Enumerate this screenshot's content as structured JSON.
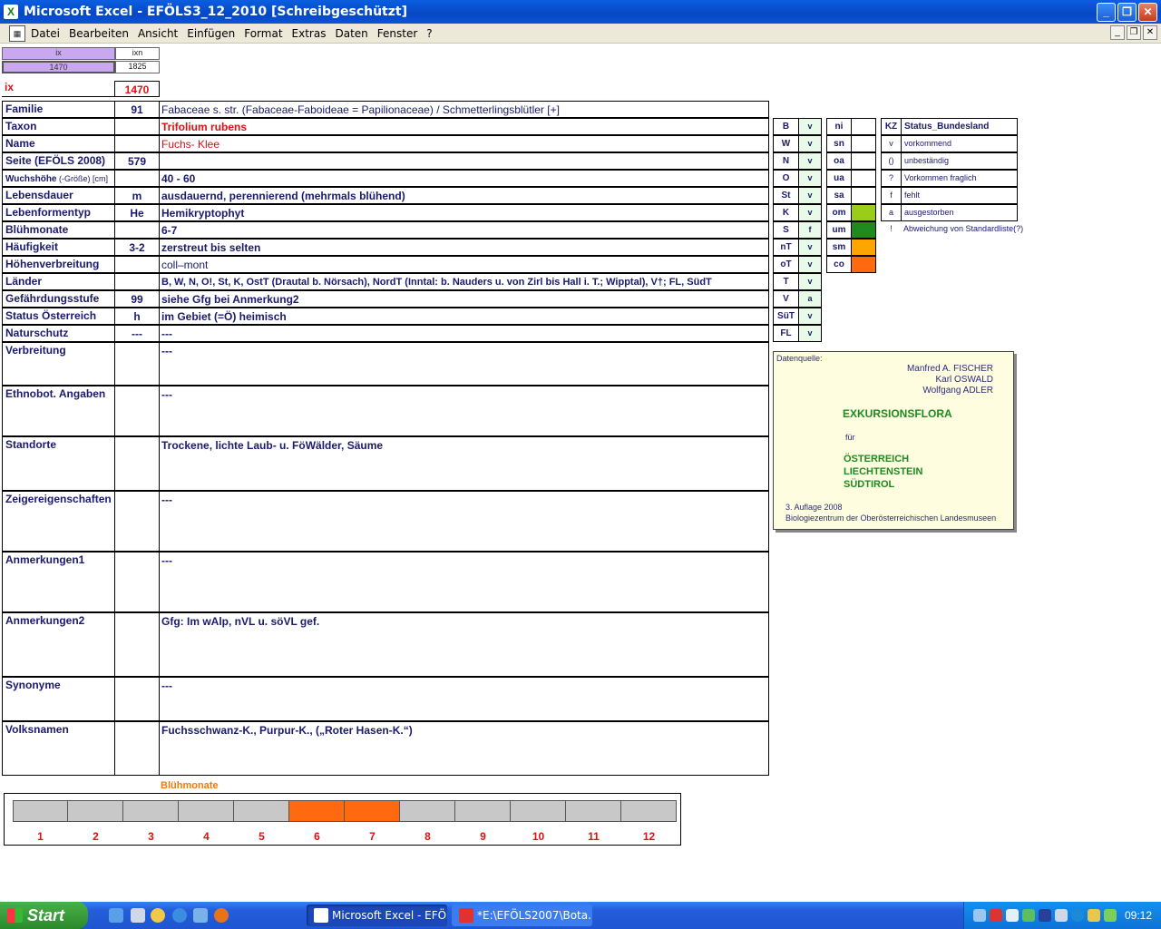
{
  "window": {
    "title": "Microsoft Excel - EFÖLS3_12_2010  [Schreibgeschützt]"
  },
  "menu": [
    "Datei",
    "Bearbeiten",
    "Ansicht",
    "Einfügen",
    "Format",
    "Extras",
    "Daten",
    "Fenster",
    "?"
  ],
  "header": {
    "ix_label": "ix",
    "ixn_label": "ixn",
    "ix_value": "1470",
    "ixn_value": "1825",
    "ix_big_label": "ix",
    "ix_big_value": "1470"
  },
  "rows": [
    {
      "label": "Familie",
      "code": "91",
      "value": "Fabaceae s. str. (Fabaceae-Faboideae = Papilionaceae)  /  Schmetterlingsblütler [+]"
    },
    {
      "label": "Taxon",
      "code": "",
      "value": "Trifolium rubens"
    },
    {
      "label": "Name",
      "code": "",
      "value": "Fuchs- Klee"
    },
    {
      "label": "Seite (EFÖLS 2008)",
      "code": "579",
      "value": ""
    },
    {
      "label": "Wuchshöhe",
      "label_suffix": "(-Größe) [cm]",
      "code": "",
      "value": "40 - 60"
    },
    {
      "label": "Lebensdauer",
      "code": "m",
      "value": "ausdauernd, perennierend (mehrmals blühend)"
    },
    {
      "label": "Lebenformentyp",
      "code": "He",
      "value": "Hemikryptophyt"
    },
    {
      "label": "Blühmonate",
      "code": "",
      "value": "6-7"
    },
    {
      "label": "Häufigkeit",
      "code": "3-2",
      "value": "zerstreut bis selten"
    },
    {
      "label": "Höhenverbreitung",
      "code": "",
      "value": "coll–mont"
    },
    {
      "label": "Länder",
      "code": "",
      "value": "B, W, N, O!, St, K, OstT (Drautal b. Nörsach), NordT (Inntal: b. Nauders u. von Zirl bis Hall i. T.; Wipptal), V†; FL, SüdT"
    },
    {
      "label": "Gefährdungsstufe",
      "code": "99",
      "value": "siehe Gfg bei Anmerkung2"
    },
    {
      "label": "Status Österreich",
      "code": "h",
      "value": "im Gebiet (=Ö) heimisch"
    },
    {
      "label": "Naturschutz",
      "code": "---",
      "value": "---"
    },
    {
      "label": "Verbreitung",
      "code": "",
      "value": "---"
    },
    {
      "label": "Ethnobot. Angaben",
      "code": "",
      "value": "---"
    },
    {
      "label": "Standorte",
      "code": "",
      "value": "Trockene, lichte Laub- u. FöWälder, Säume"
    },
    {
      "label": "Zeigereigenschaften",
      "code": "",
      "value": "---"
    },
    {
      "label": "Anmerkungen1",
      "code": "",
      "value": "---"
    },
    {
      "label": "Anmerkungen2",
      "code": "",
      "value": "Gfg: Im wAlp, nVL u. söVL gef."
    },
    {
      "label": "Synonyme",
      "code": "",
      "value": "---"
    },
    {
      "label": "Volksnamen",
      "code": "",
      "value": "Fuchsschwanz-K., Purpur-K., („Roter Hasen-K.“)"
    }
  ],
  "status_bundesland": [
    {
      "region": "B",
      "status": "v"
    },
    {
      "region": "W",
      "status": "v"
    },
    {
      "region": "N",
      "status": "v"
    },
    {
      "region": "O",
      "status": "v"
    },
    {
      "region": "St",
      "status": "v"
    },
    {
      "region": "K",
      "status": "v"
    },
    {
      "region": "S",
      "status": "f"
    },
    {
      "region": "nT",
      "status": "v"
    },
    {
      "region": "oT",
      "status": "v"
    },
    {
      "region": "T",
      "status": "v"
    },
    {
      "region": "V",
      "status": "a"
    },
    {
      "region": "SüT",
      "status": "v"
    },
    {
      "region": "FL",
      "status": "v"
    }
  ],
  "altitude": [
    {
      "code": "ni",
      "color": ""
    },
    {
      "code": "sn",
      "color": ""
    },
    {
      "code": "oa",
      "color": ""
    },
    {
      "code": "ua",
      "color": ""
    },
    {
      "code": "sa",
      "color": ""
    },
    {
      "code": "om",
      "color": "#9acd1a"
    },
    {
      "code": "um",
      "color": "#1f8a1f"
    },
    {
      "code": "sm",
      "color": "#ffa500"
    },
    {
      "code": "co",
      "color": "#ff6a10"
    }
  ],
  "legend": {
    "header": {
      "kz": "KZ",
      "title": "Status_Bundesland"
    },
    "items": [
      {
        "kz": "v",
        "text": "vorkommend"
      },
      {
        "kz": "()",
        "text": "unbeständig"
      },
      {
        "kz": "?",
        "text": "Vorkommen fraglich"
      },
      {
        "kz": "f",
        "text": "fehlt"
      },
      {
        "kz": "a",
        "text": "ausgestorben"
      },
      {
        "kz": "!",
        "text": "Abweichung von Standardliste(?)"
      }
    ]
  },
  "source": {
    "label": "Datenquelle:",
    "authors": [
      "Manfred A. FISCHER",
      "Karl OSWALD",
      "Wolfgang ADLER"
    ],
    "title": "EXKURSIONSFLORA",
    "fuer": "für",
    "countries": [
      "ÖSTERREICH",
      "LIECHTENSTEIN",
      "SÜDTIROL"
    ],
    "edition": "3. Auflage 2008",
    "publisher": "Biologiezentrum der Oberösterreichischen Landesmuseen"
  },
  "bloom": {
    "title": "Blühmonate",
    "months": [
      "1",
      "2",
      "3",
      "4",
      "5",
      "6",
      "7",
      "8",
      "9",
      "10",
      "11",
      "12"
    ],
    "active": [
      6,
      7
    ],
    "active_color": "#ff6a10",
    "inactive_color": "#c8c8c8"
  },
  "taskbar": {
    "start": "Start",
    "tasks": [
      "Microsoft Excel - EFÖ...",
      "*E:\\EFÖLS2007\\Bota..."
    ],
    "clock": "09:12"
  }
}
